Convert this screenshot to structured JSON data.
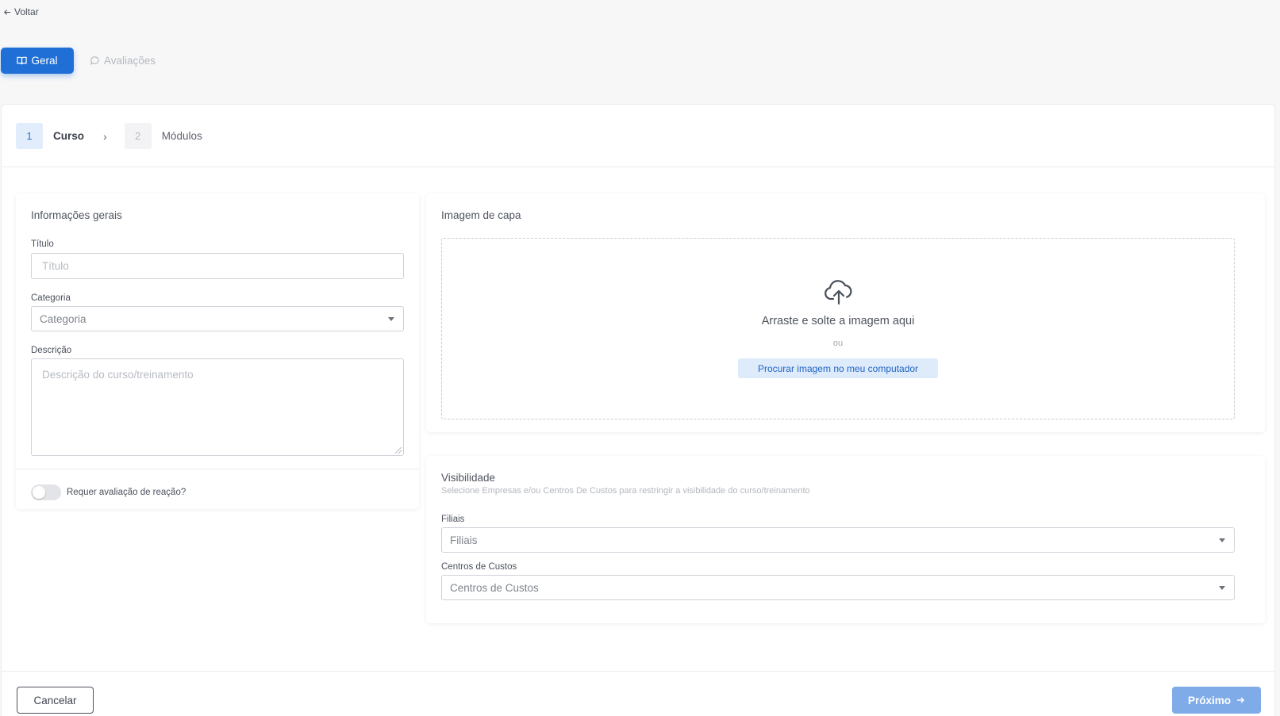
{
  "nav": {
    "back_label": "Voltar"
  },
  "tabs": [
    {
      "label": "Geral",
      "icon": "book-open-icon",
      "active": true
    },
    {
      "label": "Avaliações",
      "icon": "chat-bubble-icon",
      "active": false
    }
  ],
  "stepper": {
    "steps": [
      {
        "number": "1",
        "label": "Curso",
        "active": true
      },
      {
        "number": "2",
        "label": "Módulos",
        "active": false
      }
    ]
  },
  "general_info": {
    "title": "Informações gerais",
    "titulo_label": "Título",
    "titulo_placeholder": "Título",
    "categoria_label": "Categoria",
    "categoria_placeholder": "Categoria",
    "descricao_label": "Descrição",
    "descricao_placeholder": "Descrição do curso/treinamento",
    "toggle_label": "Requer avaliação de reação?",
    "toggle_on": false
  },
  "cover_image": {
    "title": "Imagem de capa",
    "drop_text": "Arraste e solte a imagem aqui",
    "or_text": "ou",
    "browse_label": "Procurar imagem no meu computador"
  },
  "visibility": {
    "title": "Visibilidade",
    "subtitle": "Selecione Empresas e/ou Centros De Custos para restringir a visibilidade do curso/treinamento",
    "filiais_label": "Filiais",
    "filiais_placeholder": "Filiais",
    "centros_label": "Centros de Custos",
    "centros_placeholder": "Centros de Custos"
  },
  "footer": {
    "cancel_label": "Cancelar",
    "next_label": "Próximo"
  },
  "colors": {
    "primary": "#1f6fd6",
    "primary_disabled": "#7fabe8",
    "step_active_bg": "#e2edfb"
  }
}
